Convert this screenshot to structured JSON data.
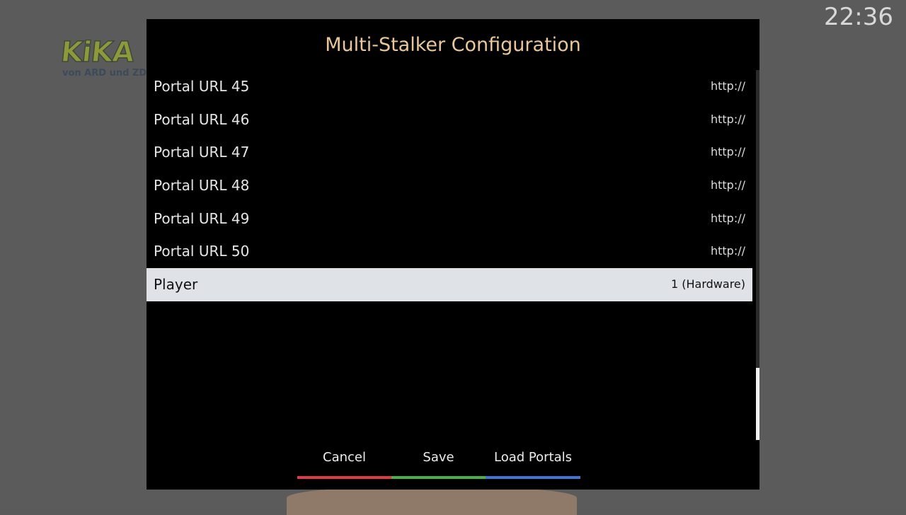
{
  "background": {
    "logo_text": "KiKA",
    "logo_subtext": "von ARD und ZDF"
  },
  "clock": "22:36",
  "dialog": {
    "title": "Multi-Stalker Configuration",
    "items": [
      {
        "label": "Portal URL 45",
        "value": "http://"
      },
      {
        "label": "Portal URL 46",
        "value": "http://"
      },
      {
        "label": "Portal URL 47",
        "value": "http://"
      },
      {
        "label": "Portal URL 48",
        "value": "http://"
      },
      {
        "label": "Portal URL 49",
        "value": "http://"
      },
      {
        "label": "Portal URL 50",
        "value": "http://"
      },
      {
        "label": "Player",
        "value": "1 (Hardware)",
        "selected": true
      }
    ],
    "buttons": {
      "cancel": {
        "label": "Cancel",
        "color": "#e03a4a"
      },
      "save": {
        "label": "Save",
        "color": "#47b347"
      },
      "load_portals": {
        "label": "Load Portals",
        "color": "#3a78d8"
      }
    }
  }
}
